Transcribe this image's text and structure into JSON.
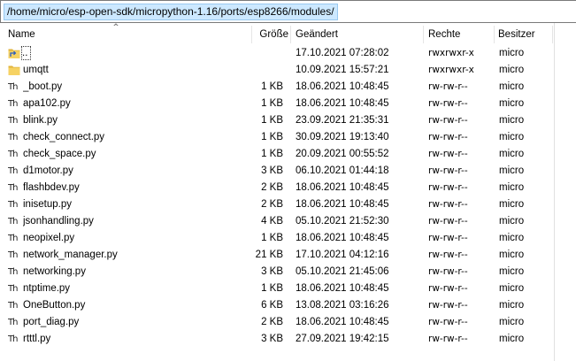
{
  "path": "/home/micro/esp-open-sdk/micropython-1.16/ports/esp8266/modules/",
  "columns": {
    "name": "Name",
    "size": "Größe",
    "modified": "Geändert",
    "permissions": "Rechte",
    "owner": "Besitzer"
  },
  "sort": {
    "column": "name",
    "direction": "ascending"
  },
  "file_icon_glyph": "Th",
  "rows": [
    {
      "type": "parent-folder",
      "name": "..",
      "size": "",
      "modified": "17.10.2021 07:28:02",
      "permissions": "rwxrwxr-x",
      "owner": "micro"
    },
    {
      "type": "folder",
      "name": "umqtt",
      "size": "",
      "modified": "10.09.2021 15:57:21",
      "permissions": "rwxrwxr-x",
      "owner": "micro"
    },
    {
      "type": "file",
      "name": "_boot.py",
      "size": "1 KB",
      "modified": "18.06.2021 10:48:45",
      "permissions": "rw-rw-r--",
      "owner": "micro"
    },
    {
      "type": "file",
      "name": "apa102.py",
      "size": "1 KB",
      "modified": "18.06.2021 10:48:45",
      "permissions": "rw-rw-r--",
      "owner": "micro"
    },
    {
      "type": "file",
      "name": "blink.py",
      "size": "1 KB",
      "modified": "23.09.2021 21:35:31",
      "permissions": "rw-rw-r--",
      "owner": "micro"
    },
    {
      "type": "file",
      "name": "check_connect.py",
      "size": "1 KB",
      "modified": "30.09.2021 19:13:40",
      "permissions": "rw-rw-r--",
      "owner": "micro"
    },
    {
      "type": "file",
      "name": "check_space.py",
      "size": "1 KB",
      "modified": "20.09.2021 00:55:52",
      "permissions": "rw-rw-r--",
      "owner": "micro"
    },
    {
      "type": "file",
      "name": "d1motor.py",
      "size": "3 KB",
      "modified": "06.10.2021 01:44:18",
      "permissions": "rw-rw-r--",
      "owner": "micro"
    },
    {
      "type": "file",
      "name": "flashbdev.py",
      "size": "2 KB",
      "modified": "18.06.2021 10:48:45",
      "permissions": "rw-rw-r--",
      "owner": "micro"
    },
    {
      "type": "file",
      "name": "inisetup.py",
      "size": "2 KB",
      "modified": "18.06.2021 10:48:45",
      "permissions": "rw-rw-r--",
      "owner": "micro"
    },
    {
      "type": "file",
      "name": "jsonhandling.py",
      "size": "4 KB",
      "modified": "05.10.2021 21:52:30",
      "permissions": "rw-rw-r--",
      "owner": "micro"
    },
    {
      "type": "file",
      "name": "neopixel.py",
      "size": "1 KB",
      "modified": "18.06.2021 10:48:45",
      "permissions": "rw-rw-r--",
      "owner": "micro"
    },
    {
      "type": "file",
      "name": "network_manager.py",
      "size": "21 KB",
      "modified": "17.10.2021 04:12:16",
      "permissions": "rw-rw-r--",
      "owner": "micro"
    },
    {
      "type": "file",
      "name": "networking.py",
      "size": "3 KB",
      "modified": "05.10.2021 21:45:06",
      "permissions": "rw-rw-r--",
      "owner": "micro"
    },
    {
      "type": "file",
      "name": "ntptime.py",
      "size": "1 KB",
      "modified": "18.06.2021 10:48:45",
      "permissions": "rw-rw-r--",
      "owner": "micro"
    },
    {
      "type": "file",
      "name": "OneButton.py",
      "size": "6 KB",
      "modified": "13.08.2021 03:16:26",
      "permissions": "rw-rw-r--",
      "owner": "micro"
    },
    {
      "type": "file",
      "name": "port_diag.py",
      "size": "2 KB",
      "modified": "18.06.2021 10:48:45",
      "permissions": "rw-rw-r--",
      "owner": "micro"
    },
    {
      "type": "file",
      "name": "rtttl.py",
      "size": "3 KB",
      "modified": "27.09.2021 19:42:15",
      "permissions": "rw-rw-r--",
      "owner": "micro"
    }
  ],
  "colors": {
    "path_highlight": "#cce8ff",
    "folder": "#f6d263",
    "folder_dark": "#e0b33a"
  }
}
